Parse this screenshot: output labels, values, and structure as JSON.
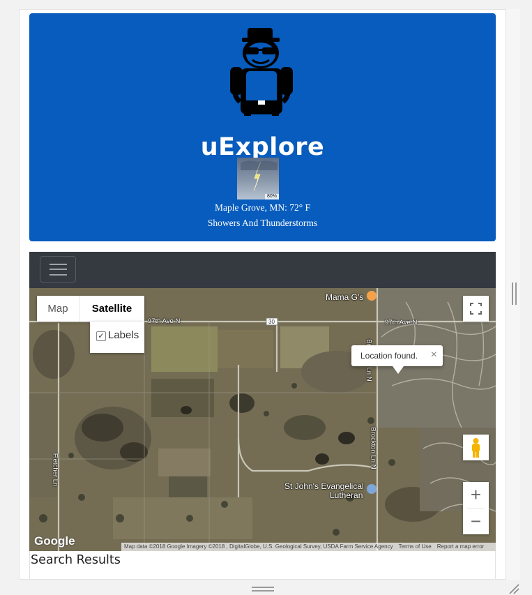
{
  "header": {
    "app_title": "uExplore",
    "weather_icon": "thunderstorm-icon",
    "precip_badge": "80%",
    "location_temp": "Maple Grove, MN: 72° F",
    "conditions": "Showers And Thunderstorms",
    "background_color": "#075cbd"
  },
  "navbar": {
    "toggle_icon": "hamburger-menu-icon",
    "background_color": "#343a40"
  },
  "map": {
    "type_options": [
      {
        "label": "Map",
        "selected": false
      },
      {
        "label": "Satellite",
        "selected": true
      }
    ],
    "labels_checkbox": {
      "label": "Labels",
      "checked": true
    },
    "info_window": "Location found.",
    "info_close": "×",
    "zoom_in": "+",
    "zoom_out": "−",
    "place_labels": {
      "mamas": "Mama G's",
      "road_97th_left": "97th Ave N",
      "road_97th_right": "97th Ave N",
      "route_30": "30",
      "brockton_upper": "Brockton Ln N",
      "brockton_lower": "Brockton Ln N",
      "fletcher": "Fletcher Ln",
      "church_line1": "St John's Evangelical",
      "church_line2": "Lutheran"
    },
    "attribution": {
      "logo": "Google",
      "data": "Map data ©2018 Google Imagery ©2018 , DigitalGlobe, U.S. Geological Survey, USDA Farm Service Agency",
      "terms": "Terms of Use",
      "report": "Report a map error"
    }
  },
  "results": {
    "title": "Search Results"
  }
}
